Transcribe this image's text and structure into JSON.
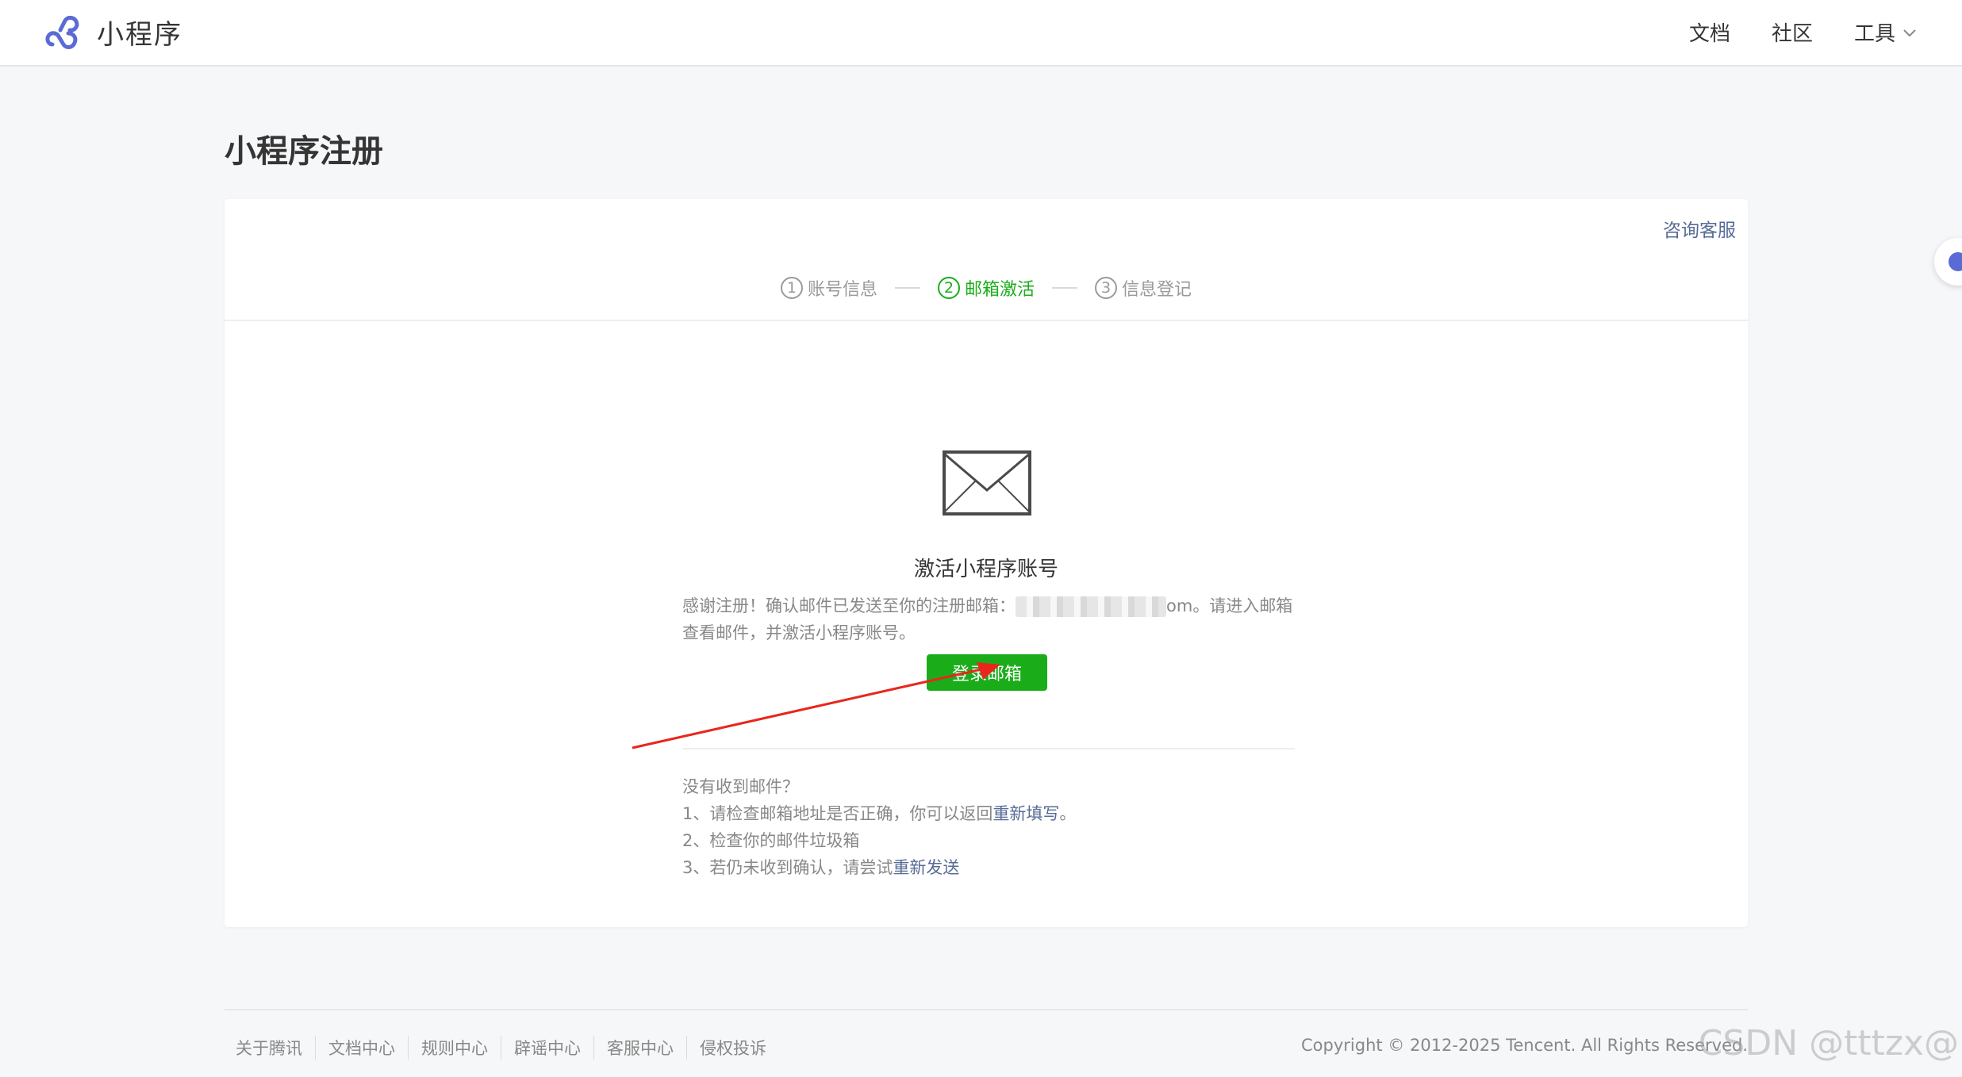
{
  "header": {
    "brand_name": "小程序",
    "nav": [
      {
        "label": "文档"
      },
      {
        "label": "社区"
      },
      {
        "label": "工具"
      }
    ]
  },
  "page": {
    "title": "小程序注册"
  },
  "panel": {
    "consult_label": "咨询客服",
    "steps": [
      {
        "number": "1",
        "label": "账号信息",
        "active": false
      },
      {
        "number": "2",
        "label": "邮箱激活",
        "active": true
      },
      {
        "number": "3",
        "label": "信息登记",
        "active": false
      }
    ],
    "activation": {
      "title": "激活小程序账号",
      "desc_prefix": "感谢注册！确认邮件已发送至你的注册邮箱：",
      "email_suffix": "om",
      "desc_suffix": "。请进入邮箱查看邮件，并激活小程序账号。",
      "login_button": "登录邮箱"
    },
    "help": {
      "title": "没有收到邮件？",
      "line1_prefix": "1、请检查邮箱地址是否正确，你可以返回",
      "line1_link": "重新填写",
      "line1_suffix": "。",
      "line2": "2、检查你的邮件垃圾箱",
      "line3_prefix": "3、若仍未收到确认，请尝试",
      "line3_link": "重新发送"
    }
  },
  "footer": {
    "links": [
      "关于腾讯",
      "文档中心",
      "规则中心",
      "辟谣中心",
      "客服中心",
      "侵权投诉"
    ],
    "copyright": "Copyright © 2012-2025 Tencent. All Rights Reserved."
  },
  "watermark": "CSDN @tttzx@",
  "colors": {
    "accent_green": "#1aad19",
    "link_blue": "#576b95",
    "brand_purple": "#5b6bd6"
  }
}
